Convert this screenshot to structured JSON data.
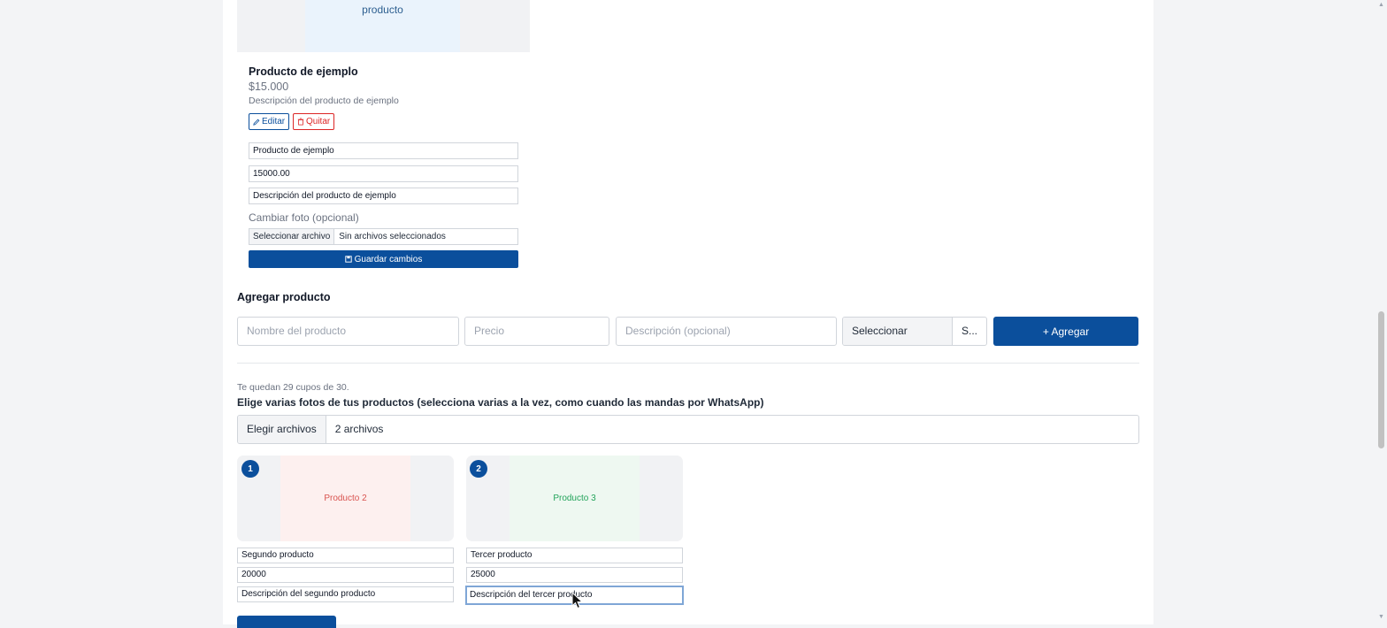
{
  "existing_product": {
    "image_label": "producto",
    "name": "Producto de ejemplo",
    "price": "$15.000",
    "description": "Descripción del producto de ejemplo",
    "edit_label": "Editar",
    "remove_label": "Quitar",
    "edit_form": {
      "name_value": "Producto de ejemplo",
      "price_value": "15000.00",
      "description_value": "Descripción del producto de ejemplo",
      "change_photo_label": "Cambiar foto (opcional)",
      "file_button": "Seleccionar archivo",
      "file_status": "Sin archivos seleccionados",
      "save_label": "Guardar cambios"
    }
  },
  "add_product": {
    "title": "Agregar producto",
    "name_placeholder": "Nombre del producto",
    "price_placeholder": "Precio",
    "description_placeholder": "Descripción (opcional)",
    "file_button": "Seleccionar archivo",
    "file_status": "S...",
    "add_label": "+ Agregar"
  },
  "bulk_upload": {
    "quota_text": "Te quedan 29 cupos de 30.",
    "instruction": "Elige varias fotos de tus productos (selecciona varias a la vez, como cuando las mandas por WhatsApp)",
    "file_button": "Elegir archivos",
    "file_status": "2 archivos",
    "previews": [
      {
        "badge": "1",
        "image_label": "Producto 2",
        "label_color": "#d9534f",
        "bg_color": "#fdf0ef",
        "name_value": "Segundo producto",
        "price_value": "20000",
        "description_value": "Descripción del segundo producto"
      },
      {
        "badge": "2",
        "image_label": "Producto 3",
        "label_color": "#22a35a",
        "bg_color": "#eef8f1",
        "name_value": "Tercer producto",
        "price_value": "25000",
        "description_value": "Descripción del tercer producto"
      }
    ]
  },
  "colors": {
    "primary": "#0b4f9c",
    "danger": "#dc2626",
    "page_bg": "#f3f4f6"
  },
  "icons": {
    "edit": "pencil-icon",
    "remove": "trash-icon",
    "save": "save-icon"
  }
}
